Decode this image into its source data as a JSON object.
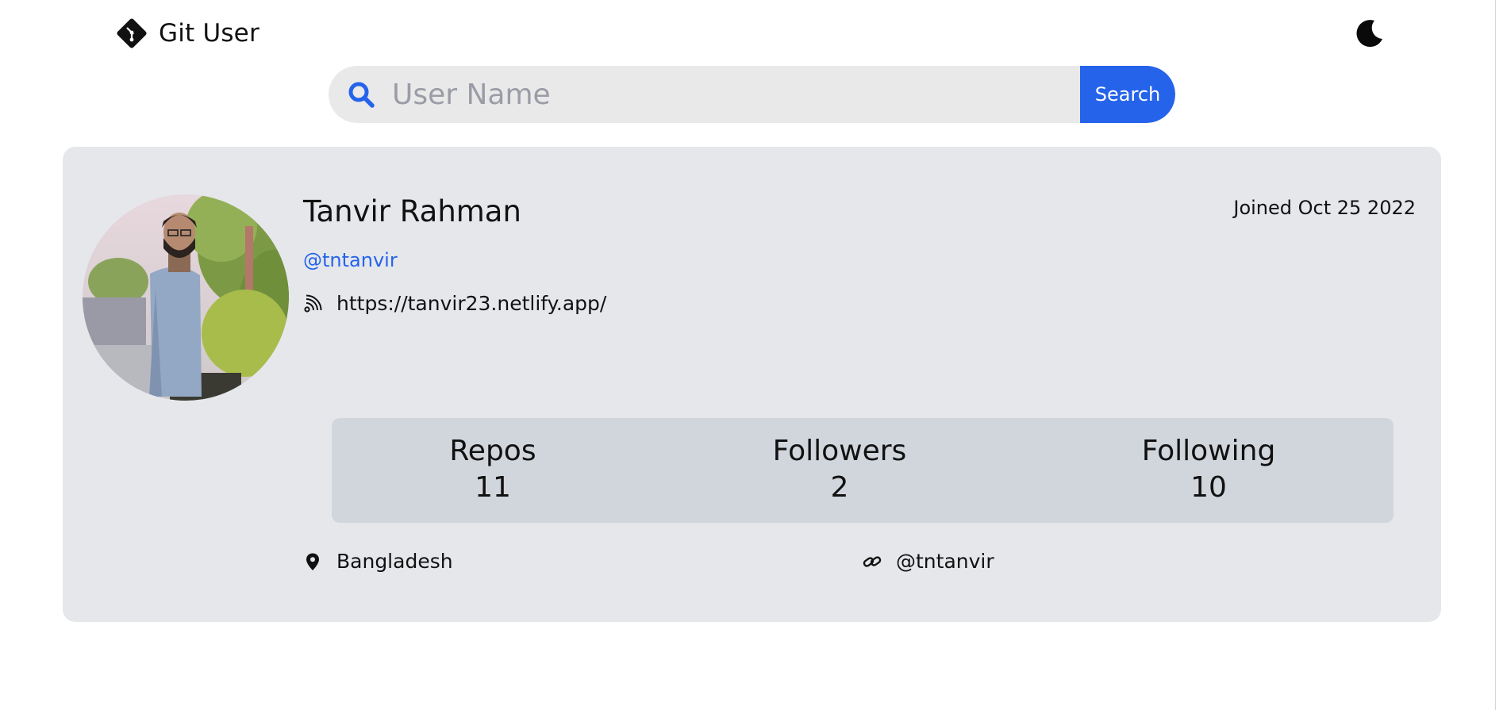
{
  "header": {
    "brand_name": "Git User",
    "brand_icon": "git-diamond-icon",
    "theme_toggle_icon": "moon-icon"
  },
  "search": {
    "icon": "search-icon",
    "placeholder": "User Name",
    "value": "",
    "button_label": "Search"
  },
  "profile": {
    "avatar": "profile-photo",
    "name": "Tanvir Rahman",
    "login": "@tntanvir",
    "joined": "Joined Oct 25 2022",
    "blog_icon": "rss-icon",
    "blog": "https://tanvir23.netlify.app/",
    "stats": [
      {
        "label": "Repos",
        "value": "11"
      },
      {
        "label": "Followers",
        "value": "2"
      },
      {
        "label": "Following",
        "value": "10"
      }
    ],
    "location_icon": "map-pin-icon",
    "location": "Bangladesh",
    "social_icon": "link-icon",
    "social": "@tntanvir"
  },
  "colors": {
    "accent": "#2563eb",
    "card_background": "#e5e7eb",
    "stats_background": "#d1d5dc",
    "search_background": "#e9e9e9"
  }
}
